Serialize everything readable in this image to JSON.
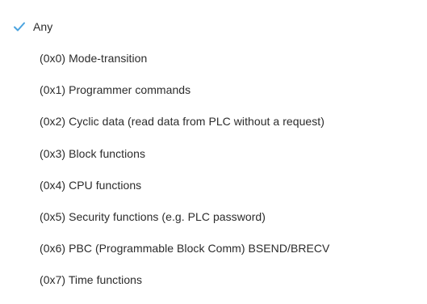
{
  "menu": {
    "accent_color": "#4aa3df",
    "items": [
      {
        "label": "Any",
        "selected": true,
        "icon": "checkmark-icon"
      },
      {
        "label": "(0x0) Mode-transition",
        "selected": false
      },
      {
        "label": "(0x1) Programmer commands",
        "selected": false
      },
      {
        "label": "(0x2) Cyclic data (read data from PLC without a request)",
        "selected": false
      },
      {
        "label": "(0x3) Block functions",
        "selected": false
      },
      {
        "label": "(0x4) CPU functions",
        "selected": false
      },
      {
        "label": "(0x5) Security functions (e.g. PLC password)",
        "selected": false
      },
      {
        "label": "(0x6) PBC (Programmable Block Comm) BSEND/BRECV",
        "selected": false
      },
      {
        "label": "(0x7) Time functions",
        "selected": false
      }
    ]
  }
}
